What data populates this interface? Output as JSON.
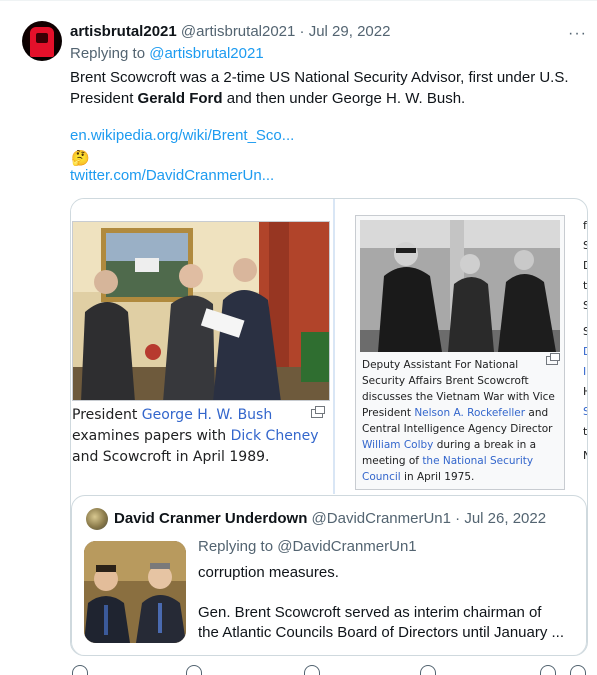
{
  "tweet": {
    "display_name": "artisbrutal2021",
    "handle": "@artisbrutal2021",
    "separator": "·",
    "time": "Jul 29, 2022",
    "more": "···",
    "replying_prefix": "Replying to",
    "replying_to": "@artisbrutal2021",
    "text_part1": "Brent Scowcroft was a 2-time US National Security Advisor, first under U.S. President",
    "text_bold": "Gerald Ford",
    "text_part2": "and then under George H. W. Bush.",
    "link1": "en.wikipedia.org/wiki/Brent_Sco...",
    "emoji": "🤔",
    "link2": "twitter.com/DavidCranmerUn..."
  },
  "card": {
    "left_caption": {
      "p1": "President",
      "link1": "George H. W. Bush",
      "p2": "examines papers with",
      "link2": "Dick Cheney",
      "p3": "and Scowcroft in April 1989."
    },
    "right_caption": {
      "p1": "Deputy Assistant For National Security Affairs Brent Scowcroft discusses the Vietnam War with Vice President",
      "link1": "Nelson A. Rockefeller",
      "p2": "and Central Intelligence Agency Director",
      "link2": "William Colby",
      "p3": "during a break in a meeting of",
      "link3": "the National Security Council",
      "p4": "in April 1975."
    },
    "edge_fragments": [
      "f",
      "S",
      "D",
      "t",
      "S",
      "S",
      "D",
      "I",
      "H",
      "S",
      "t",
      "N"
    ]
  },
  "quote": {
    "display_name": "David Cranmer Underdown",
    "handle": "@DavidCranmerUn1",
    "separator": "·",
    "time": "Jul 26, 2022",
    "replying": "Replying to @DavidCranmerUn1",
    "line1": "corruption measures.",
    "line2": "Gen. Brent Scowcroft served as interim chairman of",
    "line3": "the Atlantic Councils Board of Directors until January ..."
  },
  "colors": {
    "link": "#1d9bf0",
    "wiki_link": "#3366cc",
    "secondary": "#536471",
    "border": "#cfd9de"
  }
}
